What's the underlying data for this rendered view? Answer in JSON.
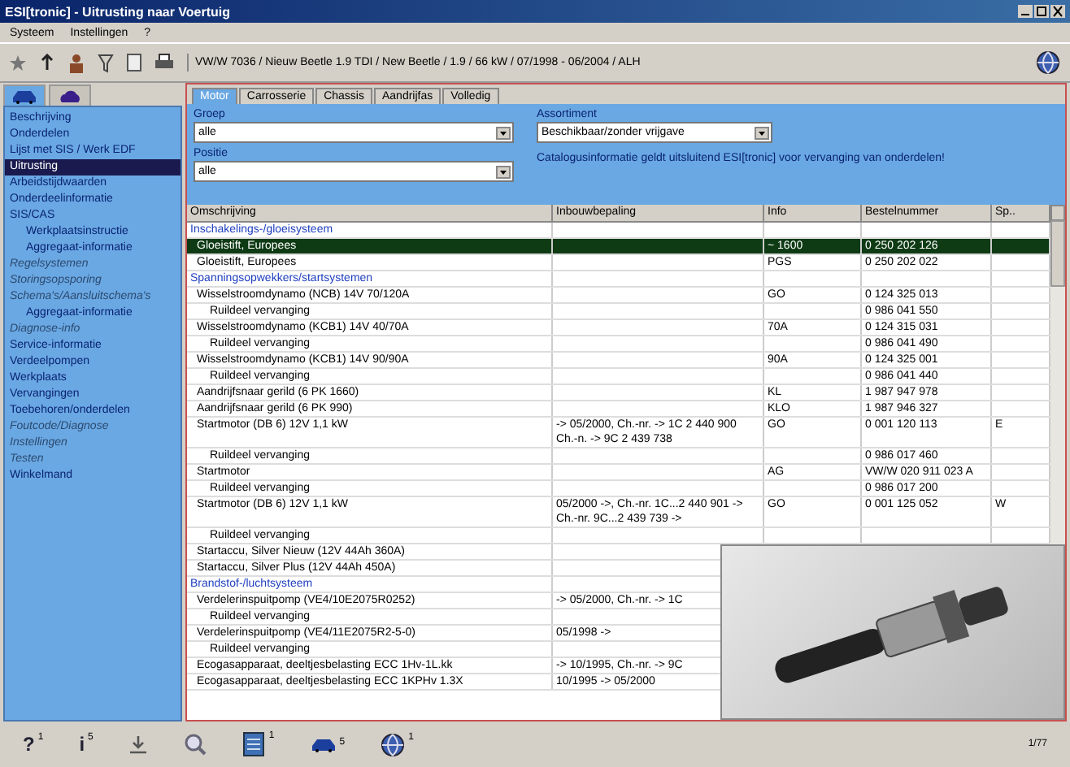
{
  "window": {
    "title": "ESI[tronic] - Uitrusting naar Voertuig"
  },
  "menu": [
    "Systeem",
    "Instellingen",
    "?"
  ],
  "toolbar": {
    "vehicle": "VW/W 7036 / Nieuw Beetle 1.9 TDI / New Beetle / 1.9 / 66 kW / 07/1998 - 06/2004 / ALH"
  },
  "sidebar": {
    "tabs": [
      {
        "kind": "car",
        "selected": true
      },
      {
        "kind": "parts",
        "selected": false
      }
    ],
    "items": [
      {
        "label": "Beschrijving",
        "selected": false,
        "disabled": false
      },
      {
        "label": "Onderdelen",
        "selected": false,
        "disabled": false
      },
      {
        "label": "Lijst met SIS / Werk EDF",
        "selected": false,
        "disabled": false
      },
      {
        "label": "Uitrusting",
        "selected": true,
        "disabled": false
      },
      {
        "label": "Arbeidstijdwaarden",
        "selected": false,
        "disabled": false
      },
      {
        "label": "Onderdeelinformatie",
        "selected": false,
        "disabled": false
      },
      {
        "label": "SIS/CAS",
        "selected": false,
        "disabled": false,
        "children": [
          {
            "label": "Werkplaatsinstructie",
            "selected": false,
            "disabled": false
          },
          {
            "label": "Aggregaat-informatie",
            "selected": false,
            "disabled": false
          }
        ]
      },
      {
        "label": "Regelsystemen",
        "selected": false,
        "disabled": true
      },
      {
        "label": "Storingsopsporing",
        "selected": false,
        "disabled": true
      },
      {
        "label": "Schema's/Aansluitschema's",
        "selected": false,
        "disabled": true,
        "children": [
          {
            "label": "Aggregaat-informatie",
            "selected": false,
            "disabled": false
          }
        ]
      },
      {
        "label": "Diagnose-info",
        "selected": false,
        "disabled": true
      },
      {
        "label": "Service-informatie",
        "selected": false,
        "disabled": false
      },
      {
        "label": "Verdeelpompen",
        "selected": false,
        "disabled": false
      },
      {
        "label": "Werkplaats",
        "selected": false,
        "disabled": false
      },
      {
        "label": "Vervangingen",
        "selected": false,
        "disabled": false
      },
      {
        "label": "Toebehoren/onderdelen",
        "selected": false,
        "disabled": false
      },
      {
        "label": "Foutcode/Diagnose",
        "selected": false,
        "disabled": true
      },
      {
        "label": "Instellingen",
        "selected": false,
        "disabled": true
      },
      {
        "label": "Testen",
        "selected": false,
        "disabled": true
      },
      {
        "label": "Winkelmand",
        "selected": false,
        "disabled": false
      }
    ]
  },
  "tabs": [
    {
      "label": "Motor",
      "selected": true
    },
    {
      "label": "Carrosserie",
      "selected": false
    },
    {
      "label": "Chassis",
      "selected": false
    },
    {
      "label": "Aandrijfas",
      "selected": false
    },
    {
      "label": "Volledig",
      "selected": false
    }
  ],
  "filters": {
    "group": {
      "label": "Groep",
      "value": "alle"
    },
    "position": {
      "label": "Positie",
      "value": "alle"
    },
    "assortment": {
      "label": "Assortiment",
      "value": "Beschikbaar/zonder vrijgave"
    },
    "note": "Catalogusinformatie geldt uitsluitend ESI[tronic] voor vervanging van onderdelen!"
  },
  "table": {
    "columns": [
      "Omschrijving",
      "Inbouwbepaling",
      "Info",
      "Bestelnummer",
      "Sp.."
    ],
    "rows": [
      {
        "kind": "group",
        "name": "Inschakelings-/gloeisysteem",
        "selected": false
      },
      {
        "kind": "item",
        "name": "Gloeistift, Europees",
        "info": "~ 1600",
        "order_no": "0 250 202 126",
        "selected": true
      },
      {
        "kind": "item",
        "name": "Gloeistift, Europees",
        "info": "PGS",
        "order_no": "0 250 202 022",
        "selected": false
      },
      {
        "kind": "group",
        "name": "Spanningsopwekkers/startsystemen",
        "selected": false
      },
      {
        "kind": "item",
        "name": "Wisselstroomdynamo (NCB) 14V 70/120A",
        "info": "GO",
        "order_no": "0 124 325 013",
        "selected": false
      },
      {
        "kind": "sub",
        "name": "Ruildeel vervanging",
        "order_no": "0 986 041 550",
        "selected": false
      },
      {
        "kind": "item",
        "name": "Wisselstroomdynamo (KCB1) 14V 40/70A",
        "info": "70A",
        "order_no": "0 124 315 031",
        "selected": false
      },
      {
        "kind": "sub",
        "name": "Ruildeel vervanging",
        "order_no": "0 986 041 490",
        "selected": false
      },
      {
        "kind": "item",
        "name": "Wisselstroomdynamo (KCB1) 14V 90/90A",
        "info": "90A",
        "order_no": "0 124 325 001",
        "selected": false
      },
      {
        "kind": "sub",
        "name": "Ruildeel vervanging",
        "order_no": "0 986 041 440",
        "selected": false
      },
      {
        "kind": "item",
        "name": "Aandrijfsnaar gerild (6 PK 1660)",
        "info": "KL",
        "order_no": "1 987 947 978",
        "selected": false
      },
      {
        "kind": "item",
        "name": "Aandrijfsnaar gerild (6 PK 990)",
        "info": "KLO",
        "order_no": "1 987 946 327",
        "selected": false
      },
      {
        "kind": "item",
        "name": "Startmotor (DB 6) 12V 1,1 kW",
        "fitting": "-> 05/2000, Ch.-nr. -> 1C 2 440 900 Ch.-n. -> 9C 2 439 738",
        "info": "GO",
        "order_no": "0 001 120 113",
        "sp": "E",
        "selected": false
      },
      {
        "kind": "sub",
        "name": "Ruildeel vervanging",
        "order_no": "0 986 017 460",
        "selected": false
      },
      {
        "kind": "item",
        "name": "Startmotor",
        "info": "AG",
        "order_no": "VW/W 020 911 023 A",
        "selected": false
      },
      {
        "kind": "sub",
        "name": "Ruildeel vervanging",
        "order_no": "0 986 017 200",
        "selected": false
      },
      {
        "kind": "item",
        "name": "Startmotor (DB 6) 12V 1,1 kW",
        "fitting": "05/2000 ->, Ch.-nr. 1C...2 440 901 -> Ch.-nr. 9C...2 439 739 ->",
        "info": "GO",
        "order_no": "0 001 125 052",
        "sp": "W",
        "selected": false
      },
      {
        "kind": "sub",
        "name": "Ruildeel vervanging",
        "selected": false
      },
      {
        "kind": "item",
        "name": "Startaccu, Silver Nieuw (12V 44Ah 360A)",
        "selected": false
      },
      {
        "kind": "item",
        "name": "Startaccu, Silver Plus (12V 44Ah 450A)",
        "selected": false
      },
      {
        "kind": "group",
        "name": "Brandstof-/luchtsysteem",
        "selected": false
      },
      {
        "kind": "item",
        "name": "Verdelerinspuitpomp (VE4/10E2075R0252)",
        "fitting": "-> 05/2000, Ch.-nr. -> 1C",
        "selected": false
      },
      {
        "kind": "sub",
        "name": "Ruildeel vervanging",
        "selected": false
      },
      {
        "kind": "item",
        "name": "Verdelerinspuitpomp (VE4/11E2075R2-5-0)",
        "fitting": "05/1998 ->",
        "selected": false
      },
      {
        "kind": "sub",
        "name": "Ruildeel vervanging",
        "selected": false
      },
      {
        "kind": "item",
        "name": "Ecogasapparaat, deeltjesbelasting ECC 1Hv-1L.kk",
        "fitting": "-> 10/1995, Ch.-nr. -> 9C",
        "selected": false
      },
      {
        "kind": "item",
        "name": "Ecogasapparaat, deeltjesbelasting ECC 1KPHv 1.3X",
        "fitting": "10/1995 -> 05/2000",
        "selected": false
      }
    ]
  },
  "statusbar": {
    "buttons": [
      {
        "kind": "help",
        "label": "?",
        "count": "1"
      },
      {
        "kind": "info",
        "label": "i",
        "count": "5"
      },
      {
        "kind": "download"
      },
      {
        "kind": "search"
      },
      {
        "kind": "document",
        "count": "1"
      },
      {
        "kind": "car",
        "count": "5"
      },
      {
        "kind": "globe",
        "count": "1"
      }
    ],
    "page": "1/77"
  }
}
